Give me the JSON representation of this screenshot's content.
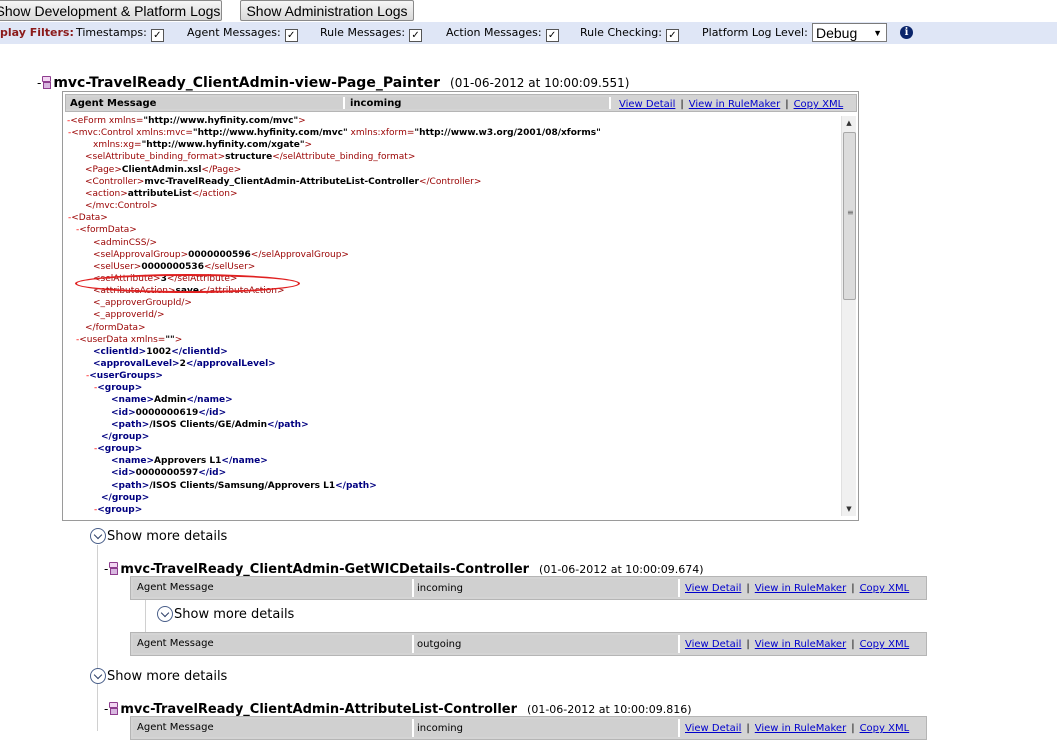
{
  "toolbar": {
    "dev_logs_label": "Show Development & Platform Logs",
    "admin_logs_label": "Show Administration Logs"
  },
  "filters": {
    "label": "play Filters:",
    "timestamps": "Timestamps:",
    "agent_messages": "Agent Messages:",
    "rule_messages": "Rule Messages:",
    "action_messages": "Action Messages:",
    "rule_checking": "Rule Checking:",
    "platform_log_level": "Platform Log Level:",
    "log_level_value": "Debug",
    "check_mark": "✓",
    "info_glyph": "i"
  },
  "entries": [
    {
      "title": "mvc-TravelReady_ClientAdmin-view-Page_Painter",
      "time": "(01-06-2012 at 10:00:09.551)",
      "messages": [
        {
          "type": "Agent Message",
          "direction": "incoming"
        }
      ]
    },
    {
      "title": "mvc-TravelReady_ClientAdmin-GetWICDetails-Controller",
      "time": "(01-06-2012 at 10:00:09.674)",
      "messages": [
        {
          "type": "Agent Message",
          "direction": "incoming"
        },
        {
          "type": "Agent Message",
          "direction": "outgoing"
        }
      ]
    },
    {
      "title": "mvc-TravelReady_ClientAdmin-AttributeList-Controller",
      "time": "(01-06-2012 at 10:00:09.816)",
      "messages": [
        {
          "type": "Agent Message",
          "direction": "incoming"
        }
      ]
    }
  ],
  "links": {
    "view_detail": "View Detail",
    "view_rulemaker": "View in RuleMaker",
    "copy_xml": "Copy XML",
    "separator": "|"
  },
  "show_more": "Show more details",
  "dash": "-",
  "xml_lines": [
    {
      "pre": "-",
      "html": "<span class='tag'>&lt;eForm</span> <span class='attr'>xmlns=</span><span class='aval'>\"http://www.hyfinity.com/mvc\"</span><span class='tag'>&gt;</span>"
    },
    {
      "pre": "-",
      "html": "<span class='tag'>&lt;mvc:Control</span> <span class='attr'>xmlns:mvc=</span><span class='aval'>\"http://www.hyfinity.com/mvc\"</span> <span class='attr'>xmlns:xform=</span><span class='aval'>\"http://www.w3.org/2001/08/xforms\"</span>"
    },
    {
      "pre": "",
      "html": "<span class='attr'>xmlns:xg=</span><span class='aval'>\"http://www.hyfinity.com/xgate\"</span><span class='tag'>&gt;</span>"
    },
    {
      "pre": "",
      "html": "<span class='tag'>&lt;selAttribute_binding_format&gt;</span><span class='txt'>structure</span><span class='tag'>&lt;/selAttribute_binding_format&gt;</span>"
    },
    {
      "pre": "",
      "html": "<span class='tag'>&lt;Page&gt;</span><span class='txt'>ClientAdmin.xsl</span><span class='tag'>&lt;/Page&gt;</span>"
    },
    {
      "pre": "",
      "html": "<span class='tag'>&lt;Controller&gt;</span><span class='txt'>mvc-TravelReady_ClientAdmin-AttributeList-Controller</span><span class='tag'>&lt;/Controller&gt;</span>"
    },
    {
      "pre": "",
      "html": "<span class='tag'>&lt;action&gt;</span><span class='txt'>attributeList</span><span class='tag'>&lt;/action&gt;</span>"
    },
    {
      "pre": "",
      "html": "<span class='tag'>&lt;/mvc:Control&gt;</span>"
    },
    {
      "pre": "-",
      "html": "<span class='tag'>&lt;Data&gt;</span>"
    },
    {
      "pre": "-",
      "html": "<span class='tag'>&lt;formData&gt;</span>"
    },
    {
      "pre": "",
      "html": "<span class='tag'>&lt;adminCSS/&gt;</span>"
    },
    {
      "pre": "",
      "html": "<span class='tag'>&lt;selApprovalGroup&gt;</span><span class='txt'>0000000596</span><span class='tag'>&lt;/selApprovalGroup&gt;</span>"
    },
    {
      "pre": "",
      "html": "<span class='tag'>&lt;selUser&gt;</span><span class='txt'>0000000536</span><span class='tag'>&lt;/selUser&gt;</span>"
    },
    {
      "pre": "",
      "html": "<span class='tag'>&lt;selAttribute&gt;</span><span class='txt'>3</span><span class='tag'>&lt;/selAttribute&gt;</span>"
    },
    {
      "pre": "",
      "html": "<span class='tag'>&lt;attributeAction&gt;</span><span class='txt'>save</span><span class='tag'>&lt;/attributeAction&gt;</span>"
    },
    {
      "pre": "",
      "html": "<span class='tag'>&lt;_approverGroupId/&gt;</span>"
    },
    {
      "pre": "",
      "html": "<span class='tag'>&lt;_approverId/&gt;</span>"
    },
    {
      "pre": "",
      "html": "<span class='tag'>&lt;/formData&gt;</span>"
    },
    {
      "pre": "-",
      "html": "<span class='tag'>&lt;userData</span> <span class='attr'>xmlns=</span><span class='aval'>\"\"</span><span class='tag'>&gt;</span>"
    },
    {
      "pre": "",
      "html": "<span class='dtag'>&lt;clientId&gt;</span><span class='txt'>1002</span><span class='dtag'>&lt;/clientId&gt;</span>"
    },
    {
      "pre": "",
      "html": "<span class='dtag'>&lt;approvalLevel&gt;</span><span class='txt'>2</span><span class='dtag'>&lt;/approvalLevel&gt;</span>"
    },
    {
      "pre": "-",
      "html": "<span class='dtag'>&lt;userGroups&gt;</span>"
    },
    {
      "pre": "-",
      "html": "<span class='dtag'>&lt;group&gt;</span>"
    },
    {
      "pre": "",
      "html": "<span class='dtag'>&lt;name&gt;</span><span class='txt'>Admin</span><span class='dtag'>&lt;/name&gt;</span>"
    },
    {
      "pre": "",
      "html": "<span class='dtag'>&lt;id&gt;</span><span class='txt'>0000000619</span><span class='dtag'>&lt;/id&gt;</span>"
    },
    {
      "pre": "",
      "html": "<span class='dtag'>&lt;path&gt;</span><span class='txt'>/ISOS Clients/GE/Admin</span><span class='dtag'>&lt;/path&gt;</span>"
    },
    {
      "pre": "",
      "html": "<span class='dtag'>&lt;/group&gt;</span>"
    },
    {
      "pre": "-",
      "html": "<span class='dtag'>&lt;group&gt;</span>"
    },
    {
      "pre": "",
      "html": "<span class='dtag'>&lt;name&gt;</span><span class='txt'>Approvers L1</span><span class='dtag'>&lt;/name&gt;</span>"
    },
    {
      "pre": "",
      "html": "<span class='dtag'>&lt;id&gt;</span><span class='txt'>0000000597</span><span class='dtag'>&lt;/id&gt;</span>"
    },
    {
      "pre": "",
      "html": "<span class='dtag'>&lt;path&gt;</span><span class='txt'>/ISOS Clients/Samsung/Approvers L1</span><span class='dtag'>&lt;/path&gt;</span>"
    },
    {
      "pre": "",
      "html": "<span class='dtag'>&lt;/group&gt;</span>"
    },
    {
      "pre": "-",
      "html": "<span class='dtag'>&lt;group&gt;</span>"
    }
  ]
}
